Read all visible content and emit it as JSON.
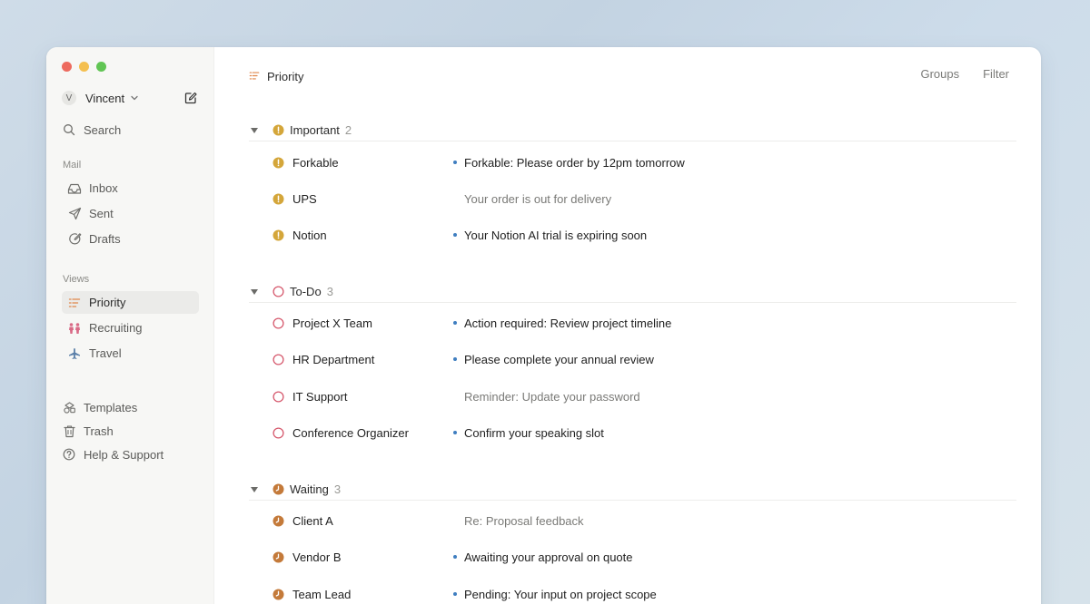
{
  "sidebar": {
    "account": {
      "initial": "V",
      "name": "Vincent"
    },
    "search": {
      "label": "Search"
    },
    "mail_section": "Mail",
    "mail_items": [
      {
        "label": "Inbox",
        "icon": "inbox-icon"
      },
      {
        "label": "Sent",
        "icon": "send-icon"
      },
      {
        "label": "Drafts",
        "icon": "drafts-icon"
      }
    ],
    "views_section": "Views",
    "views_items": [
      {
        "label": "Priority",
        "icon": "priority-list-icon",
        "active": true
      },
      {
        "label": "Recruiting",
        "icon": "people-icon"
      },
      {
        "label": "Travel",
        "icon": "airplane-icon"
      }
    ],
    "bottom_items": [
      {
        "label": "Templates",
        "icon": "templates-icon"
      },
      {
        "label": "Trash",
        "icon": "trash-icon"
      },
      {
        "label": "Help & Support",
        "icon": "help-icon"
      }
    ]
  },
  "main": {
    "title": "Priority",
    "actions": {
      "groups": "Groups",
      "filter": "Filter"
    },
    "groups": [
      {
        "name": "Important",
        "count": "2",
        "icon": "important-icon",
        "rows": [
          {
            "sender": "Forkable",
            "subject": "Forkable: Please order by 12pm tomorrow",
            "unread": true
          },
          {
            "sender": "UPS",
            "subject": "Your order is out for delivery",
            "unread": false
          },
          {
            "sender": "Notion",
            "subject": "Your Notion AI trial is expiring soon",
            "unread": true
          }
        ]
      },
      {
        "name": "To-Do",
        "count": "3",
        "icon": "todo-circle-icon",
        "rows": [
          {
            "sender": "Project X Team",
            "subject": "Action required: Review project timeline",
            "unread": true
          },
          {
            "sender": "HR Department",
            "subject": "Please complete your annual review",
            "unread": true
          },
          {
            "sender": "IT Support",
            "subject": "Reminder: Update your password",
            "unread": false
          },
          {
            "sender": "Conference Organizer",
            "subject": "Confirm your speaking slot",
            "unread": true
          }
        ]
      },
      {
        "name": "Waiting",
        "count": "3",
        "icon": "clock-icon",
        "rows": [
          {
            "sender": "Client A",
            "subject": "Re: Proposal feedback",
            "unread": false
          },
          {
            "sender": "Vendor B",
            "subject": "Awaiting your approval on quote",
            "unread": true
          },
          {
            "sender": "Team Lead",
            "subject": "Pending: Your input on project scope",
            "unread": true
          }
        ]
      }
    ]
  },
  "colors": {
    "important": "#d4a63a",
    "todo": "#d65a6e",
    "waiting": "#c47a3a",
    "unread_dot": "#3f7ec0",
    "priority_icon": "#e0864a"
  }
}
